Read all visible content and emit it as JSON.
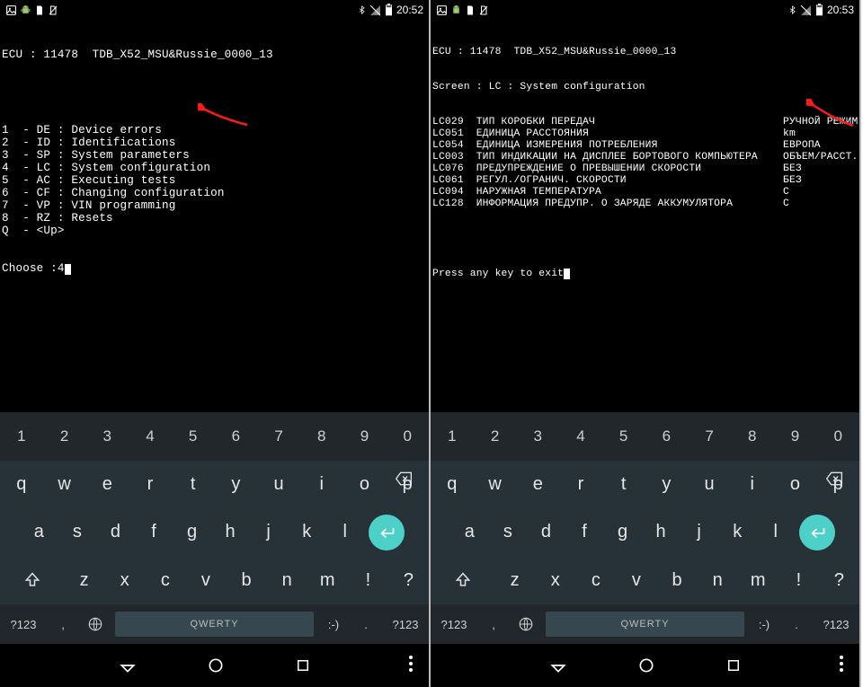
{
  "left": {
    "status": {
      "time": "20:52"
    },
    "terminal": {
      "header": "ECU : 11478  TDB_X52_MSU&Russie_0000_13",
      "menu": [
        "1  - DE : Device errors",
        "2  - ID : Identifications",
        "3  - SP : System parameters",
        "4  - LC : System configuration",
        "5  - AC : Executing tests",
        "6  - CF : Changing configuration",
        "7  - VP : VIN programming",
        "8  - RZ : Resets",
        "Q  - <Up>"
      ],
      "prompt": "Choose :4"
    },
    "arrow_target_line": 3
  },
  "right": {
    "status": {
      "time": "20:53"
    },
    "terminal": {
      "header": "ECU : 11478  TDB_X52_MSU&Russie_0000_13",
      "subheader": "Screen : LC : System configuration",
      "rows": [
        {
          "code": "LC029",
          "label": "ТИП КОРОБКИ ПЕРЕДАЧ",
          "value": "РУЧНОЙ РЕЖИМ"
        },
        {
          "code": "LC051",
          "label": "ЕДИНИЦА РАССТОЯНИЯ",
          "value": "km"
        },
        {
          "code": "LC054",
          "label": "ЕДИНИЦА ИЗМЕРЕНИЯ ПОТРЕБЛЕНИЯ",
          "value": "ЕВРОПА"
        },
        {
          "code": "LC003",
          "label": "ТИП ИНДИКАЦИИ НА ДИСПЛЕЕ БОРТОВОГО КОМПЬЮТЕРА",
          "value": "ОБЪЕМ/РАССТ."
        },
        {
          "code": "LC076",
          "label": "ПРЕДУПРЕЖДЕНИЕ О ПРЕВЫШЕНИИ СКОРОСТИ",
          "value": "БЕЗ"
        },
        {
          "code": "LC061",
          "label": "РЕГУЛ./ОГРАНИЧ. СКОРОСТИ",
          "value": "БЕЗ"
        },
        {
          "code": "LC094",
          "label": "НАРУЖНАЯ ТЕМПЕРАТУРА",
          "value": "С"
        },
        {
          "code": "LC128",
          "label": "ИНФОРМАЦИЯ ПРЕДУПР. О ЗАРЯДЕ АККУМУЛЯТОРА",
          "value": "С"
        }
      ],
      "footer": "Press any key to exit"
    },
    "arrow_target_line": 5
  },
  "keyboard": {
    "numbers": [
      "1",
      "2",
      "3",
      "4",
      "5",
      "6",
      "7",
      "8",
      "9",
      "0"
    ],
    "row1": [
      "q",
      "w",
      "e",
      "r",
      "t",
      "y",
      "u",
      "i",
      "o",
      "p"
    ],
    "row2": [
      "a",
      "s",
      "d",
      "f",
      "g",
      "h",
      "j",
      "k",
      "l"
    ],
    "row3": [
      "z",
      "x",
      "c",
      "v",
      "b",
      "n",
      "m",
      "!",
      "?"
    ],
    "space_label": "QWERTY",
    "sym_label": "?123",
    "emoji_label": ":-)",
    "dot_label": ".",
    "comma_label": ","
  }
}
